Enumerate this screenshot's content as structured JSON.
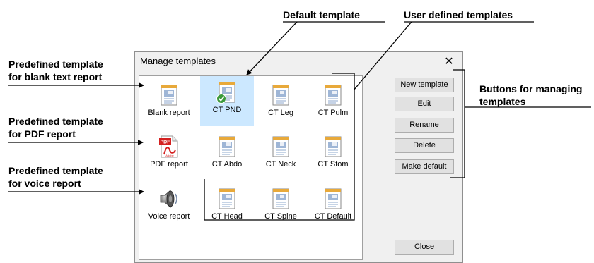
{
  "dialog": {
    "title": "Manage templates",
    "close_glyph": "✕",
    "templates": [
      {
        "label": "Blank report",
        "icon": "document-icon"
      },
      {
        "label": "CT PND",
        "icon": "document-default-icon",
        "selected": true
      },
      {
        "label": "CT Leg",
        "icon": "document-icon"
      },
      {
        "label": "CT Pulm",
        "icon": "document-icon"
      },
      {
        "label": "PDF report",
        "icon": "pdf-icon"
      },
      {
        "label": "CT Abdo",
        "icon": "document-icon"
      },
      {
        "label": "CT Neck",
        "icon": "document-icon"
      },
      {
        "label": "CT Stom",
        "icon": "document-icon"
      },
      {
        "label": "Voice report",
        "icon": "speaker-icon"
      },
      {
        "label": "CT Head",
        "icon": "document-icon"
      },
      {
        "label": "CT Spine",
        "icon": "document-icon"
      },
      {
        "label": "CT Default",
        "icon": "document-icon"
      }
    ],
    "buttons": {
      "new_template": "New template",
      "edit": "Edit",
      "rename": "Rename",
      "delete": "Delete",
      "make_default": "Make default",
      "close": "Close"
    }
  },
  "callouts": {
    "default_template": "Default template",
    "user_defined": "User defined templates",
    "blank_text_line1": "Predefined template",
    "blank_text_line2": "for blank text report",
    "pdf_line1": "Predefined template",
    "pdf_line2": "for PDF report",
    "voice_line1": "Predefined template",
    "voice_line2": "for voice report",
    "buttons_line1": "Buttons for managing",
    "buttons_line2": "templates"
  },
  "pdf_icon_text": {
    "top": "PDF",
    "bottom": "Adobe"
  },
  "colors": {
    "selection": "#cce8ff",
    "default_check": "#3c9a3c",
    "pdf_red": "#d42020",
    "page_gold": "#e8a93a",
    "page_blue": "#9fb6d6"
  }
}
